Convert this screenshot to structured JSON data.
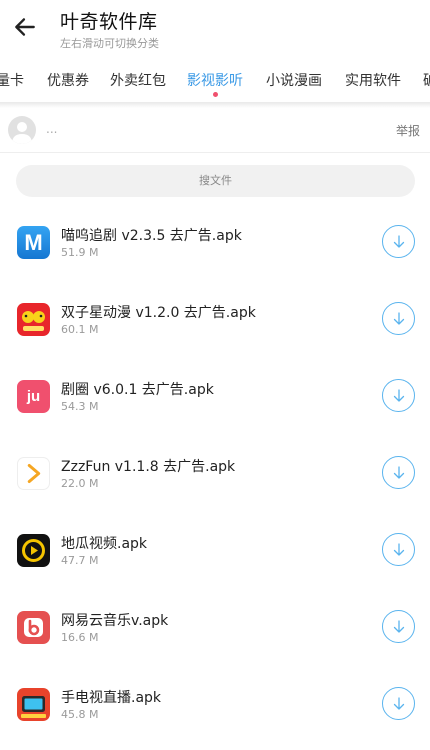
{
  "header": {
    "title": "叶奇软件库",
    "subtitle": "左右滑动可切换分类"
  },
  "tabs": [
    {
      "label": "量卡"
    },
    {
      "label": "优惠券"
    },
    {
      "label": "外卖红包"
    },
    {
      "label": "影视影听",
      "active": true
    },
    {
      "label": "小说漫画"
    },
    {
      "label": "实用软件"
    },
    {
      "label": "破"
    }
  ],
  "user": {
    "name": "...",
    "report_label": "举报"
  },
  "search": {
    "label": "搜文件"
  },
  "files": [
    {
      "name": "喵呜追剧 v2.3.5 去广告.apk",
      "size": "51.9 M",
      "icon": "app-icon-miaowu",
      "color": "#1f8fe0"
    },
    {
      "name": "双子星动漫 v1.2.0 去广告.apk",
      "size": "60.1 M",
      "icon": "app-icon-shuangzixing",
      "color": "#e8262b"
    },
    {
      "name": "剧圈 v6.0.1 去广告.apk",
      "size": "54.3 M",
      "icon": "app-icon-juquan",
      "color": "#f0506e"
    },
    {
      "name": "ZzzFun v1.1.8 去广告.apk",
      "size": "22.0 M",
      "icon": "app-icon-zzzfun",
      "color": "#f5a623"
    },
    {
      "name": "地瓜视频.apk",
      "size": "47.7 M",
      "icon": "app-icon-digua",
      "color": "#f5c400"
    },
    {
      "name": "网易云音乐v.apk",
      "size": "16.6 M",
      "icon": "app-icon-netease-music",
      "color": "#e55050"
    },
    {
      "name": "手电视直播.apk",
      "size": "45.8 M",
      "icon": "app-icon-tv-live",
      "color": "#e8432b"
    }
  ],
  "icon_text": {
    "miaowu": "M",
    "juquan": "ju"
  },
  "colors": {
    "accent": "#3b9ae6",
    "tab_dot": "#f0506e",
    "download": "#5ab4ee"
  }
}
